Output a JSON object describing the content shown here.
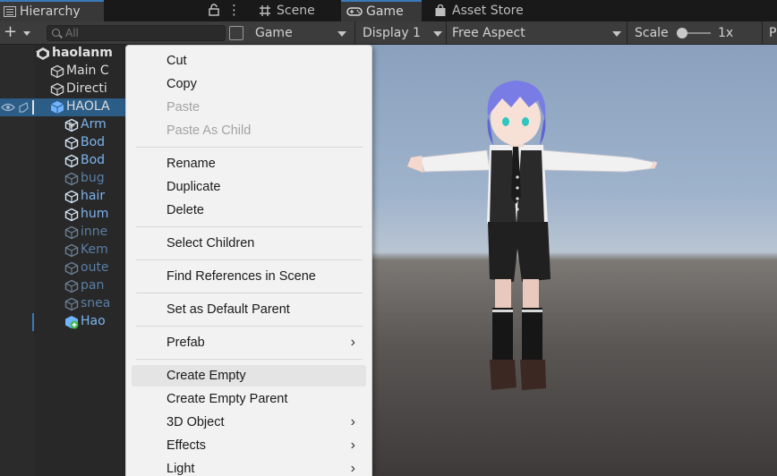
{
  "hierarchy": {
    "tab_label": "Hierarchy",
    "search_placeholder": "All",
    "rows": [
      {
        "label": "haolanm",
        "style": "bold",
        "icon": "unity-scene-icon"
      },
      {
        "label": "Main C",
        "style": "white",
        "icon": "cube-icon"
      },
      {
        "label": "Directi",
        "style": "white",
        "icon": "cube-icon"
      },
      {
        "label": "HAOLA",
        "style": "white",
        "icon": "prefab-cube-icon"
      },
      {
        "label": "Arm",
        "style": "blue",
        "icon": "cube-icon"
      },
      {
        "label": "Bod",
        "style": "blue",
        "icon": "cube-icon"
      },
      {
        "label": "Bod",
        "style": "blue",
        "icon": "cube-icon"
      },
      {
        "label": "bug",
        "style": "dim",
        "icon": "cube-icon"
      },
      {
        "label": "hair",
        "style": "blue",
        "icon": "cube-icon"
      },
      {
        "label": "hum",
        "style": "blue",
        "icon": "cube-icon"
      },
      {
        "label": "inne",
        "style": "dim",
        "icon": "cube-icon"
      },
      {
        "label": "Kem",
        "style": "dim",
        "icon": "cube-icon"
      },
      {
        "label": "oute",
        "style": "dim",
        "icon": "cube-icon"
      },
      {
        "label": "pan",
        "style": "dim",
        "icon": "cube-icon"
      },
      {
        "label": "snea",
        "style": "dim",
        "icon": "cube-icon"
      },
      {
        "label": "Hao",
        "style": "blue",
        "icon": "prefab-add-icon"
      }
    ]
  },
  "tabs": {
    "scene": "Scene",
    "game": "Game",
    "asset_store": "Asset Store"
  },
  "game_toolbar": {
    "mode": "Game",
    "display": "Display 1",
    "aspect": "Free Aspect",
    "scale_label": "Scale",
    "scale_value": "1x",
    "cut_off": "P"
  },
  "context_menu": {
    "cut": "Cut",
    "copy": "Copy",
    "paste": "Paste",
    "paste_as_child": "Paste As Child",
    "rename": "Rename",
    "duplicate": "Duplicate",
    "delete": "Delete",
    "select_children": "Select Children",
    "find_references": "Find References in Scene",
    "set_default_parent": "Set as Default Parent",
    "prefab": "Prefab",
    "create_empty": "Create Empty",
    "create_empty_parent": "Create Empty Parent",
    "object_3d": "3D Object",
    "effects": "Effects",
    "light": "Light"
  },
  "colors": {
    "selection": "#2c5d87",
    "accent": "#3a79bb",
    "menu_bg": "#f2f2f2"
  }
}
